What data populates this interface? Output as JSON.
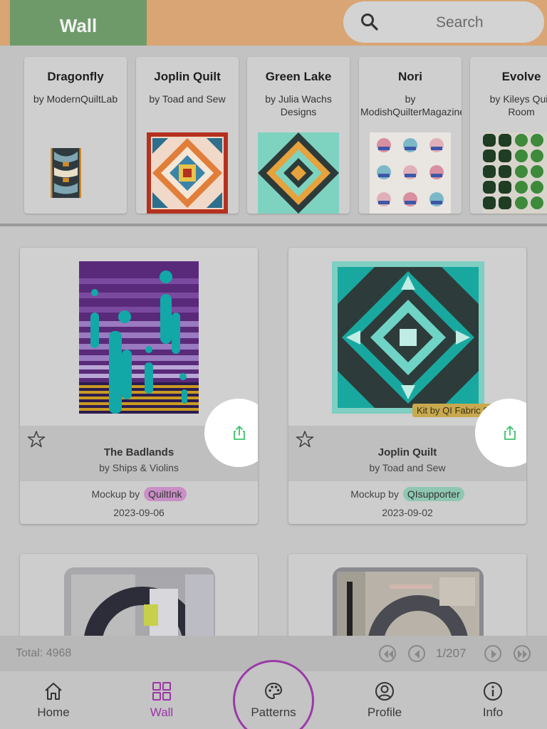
{
  "header": {
    "active_tab": "Wall",
    "search_placeholder": "Search",
    "search_icon": "search-icon"
  },
  "featured": [
    {
      "title": "Dragonfly",
      "author": "by ModernQuiltLab"
    },
    {
      "title": "Joplin Quilt",
      "author": "by Toad and Sew"
    },
    {
      "title": "Green Lake",
      "author": "by Julia Wachs\nDesigns"
    },
    {
      "title": "Nori",
      "author": "by\nModishQuilterMagazine"
    },
    {
      "title": "Evolve",
      "author": "by Kileys Quilt\nRoom"
    }
  ],
  "cards": [
    {
      "name": "The Badlands",
      "author": "by Ships & Violins",
      "mockup_prefix": "Mockup by",
      "mockup_user": "QuiltInk",
      "mockup_color": "#c98fc6",
      "date": "2023-09-06"
    },
    {
      "name": "Joplin Quilt",
      "author": "by Toad and Sew",
      "kit_badge": "Kit by QI Fabric Shop",
      "mockup_prefix": "Mockup by",
      "mockup_user": "QIsupporter",
      "mockup_color": "#8fc7b2",
      "date": "2023-09-02"
    }
  ],
  "pager": {
    "total": "Total: 4968",
    "page": "1/207"
  },
  "nav": [
    {
      "label": "Home",
      "icon": "home-icon"
    },
    {
      "label": "Wall",
      "icon": "grid-icon",
      "active": true
    },
    {
      "label": "Patterns",
      "icon": "palette-icon"
    },
    {
      "label": "Profile",
      "icon": "user-circle-icon"
    },
    {
      "label": "Info",
      "icon": "info-icon"
    }
  ],
  "colors": {
    "header": "#d9a574",
    "active_tab": "#6e9a6a",
    "accent_purple": "#9b35a7",
    "share_green": "#3cc26a"
  }
}
